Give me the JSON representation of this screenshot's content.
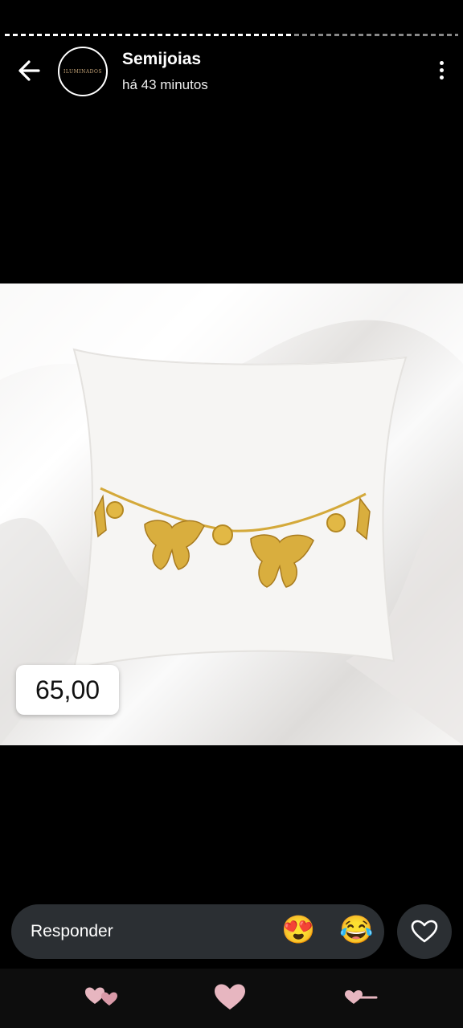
{
  "story": {
    "account_name": "Semijoias",
    "posted_time": "há 43 minutos",
    "avatar_logo": "ILUMINADOS"
  },
  "product": {
    "price": "65,00"
  },
  "reply_bar": {
    "placeholder": "Responder",
    "emoji_1": "😍",
    "emoji_2": "😂"
  },
  "icons": {
    "back": "arrow-left-icon",
    "menu": "more-vertical-icon",
    "like": "heart-outline-icon"
  },
  "colors": {
    "gold": "#d4a93a",
    "reply_bg": "#2b2f33",
    "nav_pink": "#e7b6c0"
  }
}
